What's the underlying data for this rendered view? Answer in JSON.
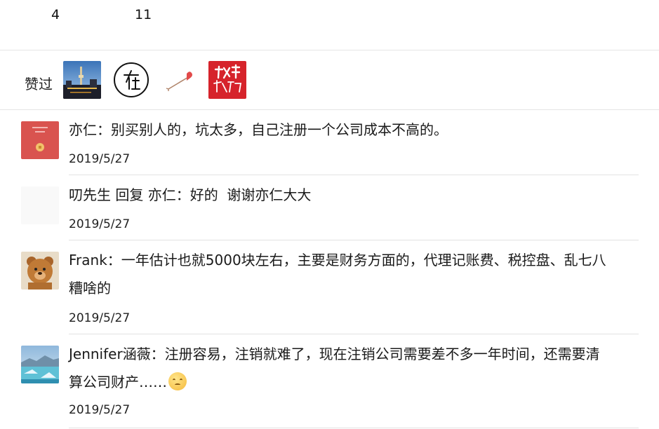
{
  "counts": {
    "first": "4",
    "second": "11"
  },
  "likes": {
    "label": "赞过"
  },
  "comments": [
    {
      "text": "亦仁：别买别人的，坑太多，自己注册一个公司成本不高的。",
      "date": "2019/5/27"
    },
    {
      "text": "叨先生 回复 亦仁：好的  谢谢亦仁大大",
      "date": "2019/5/27"
    },
    {
      "line1": "Frank：一年估计也就5000块左右，主要是财务方面的，代理记账费、税控盘、乱七八",
      "line2": "糟啥的",
      "date": "2019/5/27"
    },
    {
      "line1": "Jennifer涵薇：注册容易，注销就难了，现在注销公司需要差不多一年时间，还需要清",
      "line2": "算公司财产……",
      "date": "2019/5/27"
    }
  ],
  "colors": {
    "divider": "#e2e2e2",
    "red_avatar": "#d9534f"
  },
  "icons": [
    "city-night-avatar",
    "circle-char-avatar",
    "cupid-arrow-avatar",
    "red-calligraphy-avatar",
    "red-envelope-avatar",
    "blank-avatar",
    "teddy-bear-avatar",
    "ice-landscape-avatar",
    "sad-face-emoji-icon"
  ]
}
